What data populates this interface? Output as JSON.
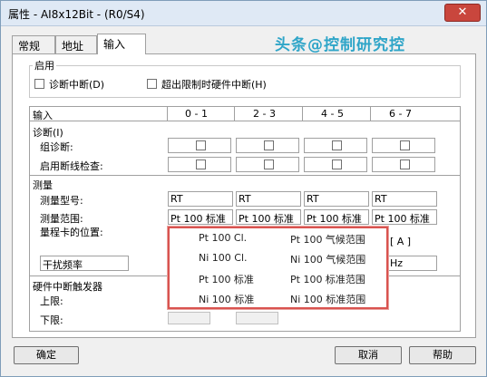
{
  "window": {
    "title": "属性 - AI8x12Bit - (R0/S4)",
    "close_glyph": "✕"
  },
  "tabs": [
    "常规",
    "地址",
    "输入"
  ],
  "watermark": "头条@控制研究控",
  "enable_group": {
    "title": "启用",
    "diag_interrupt": "诊断中断(D)",
    "hw_interrupt": "超出限制时硬件中断(H)"
  },
  "table": {
    "header": "输入",
    "columns": [
      "0 - 1",
      "2 - 3",
      "4 - 5",
      "6 - 7"
    ],
    "diag_section": "诊断(I)",
    "group_diag": "组诊断:",
    "wire_check": "启用断线检查:",
    "measure_section": "测量",
    "measure_type": "测量型号:",
    "measure_range": "测量范围:",
    "range_card": "量程卡的位置:",
    "measure_type_values": [
      "RT",
      "RT",
      "RT",
      "RT"
    ],
    "measure_range_values": [
      "Pt 100 标准",
      "Pt 100 标准",
      "Pt 100 标准",
      "Pt 100 标准"
    ],
    "range_card_suffix": "[ A ]",
    "freq_label": "干扰频率",
    "freq_suffix": "Hz",
    "hw_trigger": "硬件中断触发器",
    "upper": "上限:",
    "lower": "下限:"
  },
  "popup_options": [
    [
      "Pt 100 Cl.",
      "Pt 100 气候范围"
    ],
    [
      "Ni 100 Cl.",
      "Ni 100 气候范围"
    ],
    [
      "Pt 100 标准",
      "Pt 100 标准范围"
    ],
    [
      "Ni 100 标准",
      "Ni 100 标准范围"
    ]
  ],
  "buttons": {
    "ok": "确定",
    "cancel": "取消",
    "help": "帮助"
  }
}
